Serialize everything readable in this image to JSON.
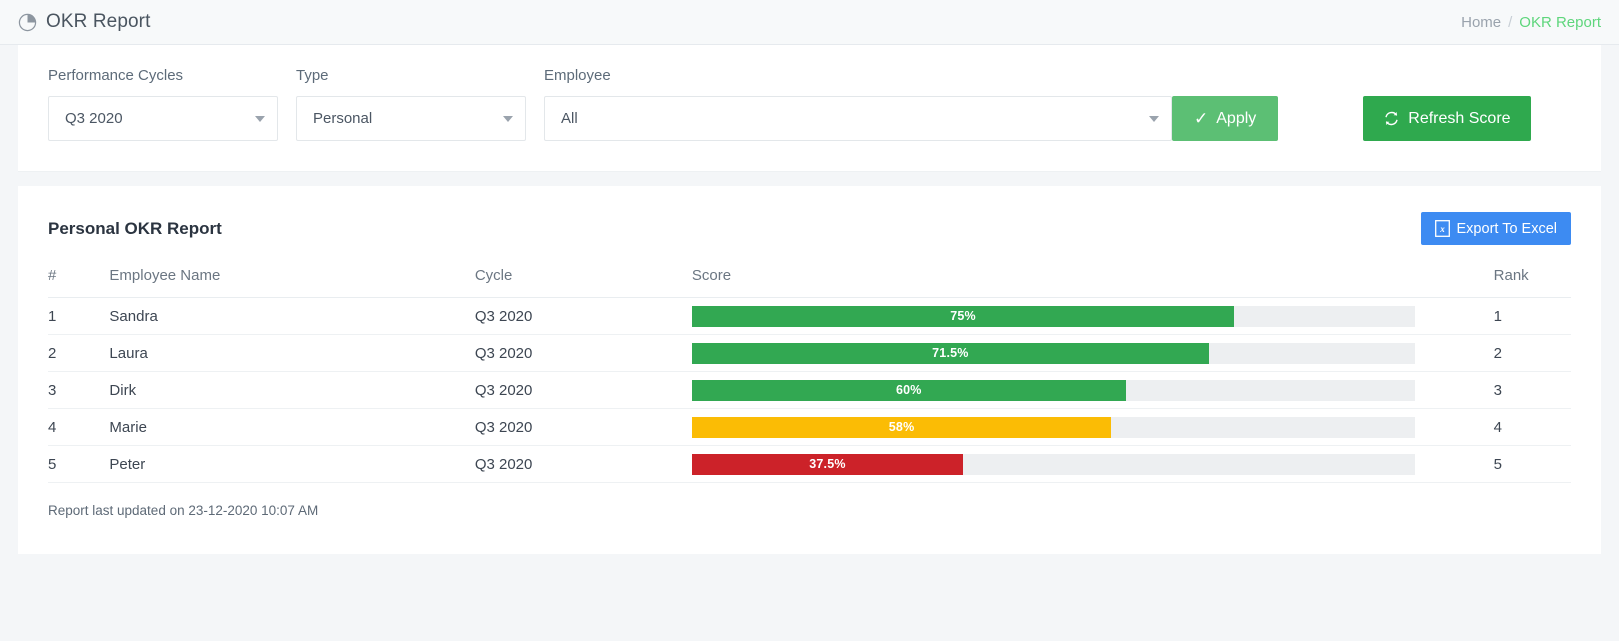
{
  "header": {
    "icon": "pie-chart-icon",
    "title": "OKR Report",
    "breadcrumb": {
      "home": "Home",
      "separator": "/",
      "current": "OKR Report"
    }
  },
  "filters": {
    "cycles": {
      "label": "Performance Cycles",
      "value": "Q3 2020"
    },
    "type": {
      "label": "Type",
      "value": "Personal"
    },
    "employee": {
      "label": "Employee",
      "value": "All"
    },
    "apply_button": {
      "label": "Apply",
      "icon": "check-icon"
    },
    "refresh_button": {
      "label": "Refresh Score",
      "icon": "refresh-icon"
    }
  },
  "report": {
    "title": "Personal OKR Report",
    "export_button": {
      "label": "Export To Excel",
      "icon": "excel-file-icon"
    },
    "columns": [
      "#",
      "Employee Name",
      "Cycle",
      "Score",
      "Rank"
    ],
    "rows": [
      {
        "index": "1",
        "name": "Sandra",
        "cycle": "Q3 2020",
        "score_label": "75%",
        "rank": "1"
      },
      {
        "index": "2",
        "name": "Laura",
        "cycle": "Q3 2020",
        "score_label": "71.5%",
        "rank": "2"
      },
      {
        "index": "3",
        "name": "Dirk",
        "cycle": "Q3 2020",
        "score_label": "60%",
        "rank": "3"
      },
      {
        "index": "4",
        "name": "Marie",
        "cycle": "Q3 2020",
        "score_label": "58%",
        "rank": "4"
      },
      {
        "index": "5",
        "name": "Peter",
        "cycle": "Q3 2020",
        "score_label": "37.5%",
        "rank": "5"
      }
    ],
    "footer_note": "Report last updated on 23-12-2020 10:07 AM"
  },
  "chart_data": {
    "type": "bar",
    "title": "Personal OKR Report",
    "orientation": "horizontal",
    "categories": [
      "Sandra",
      "Laura",
      "Dirk",
      "Marie",
      "Peter"
    ],
    "values": [
      75,
      71.5,
      60,
      58,
      37.5
    ],
    "value_labels": [
      "75%",
      "71.5%",
      "60%",
      "58%",
      "37.5%"
    ],
    "bar_colors": [
      "#32a852",
      "#32a852",
      "#32a852",
      "#fbbc05",
      "#cc2229"
    ],
    "track_color": "#edeff1",
    "xlabel": "Score",
    "ylabel": "Employee Name",
    "xlim": [
      0,
      100
    ],
    "grid": false,
    "legend": false
  },
  "colors": {
    "apply_green": "#5cbf74",
    "refresh_green": "#2fa94e",
    "export_blue": "#3d8bf2",
    "bar_green": "#32a852",
    "bar_yellow": "#fbbc05",
    "bar_red": "#cc2229",
    "breadcrumb_active": "#5ed67c"
  }
}
